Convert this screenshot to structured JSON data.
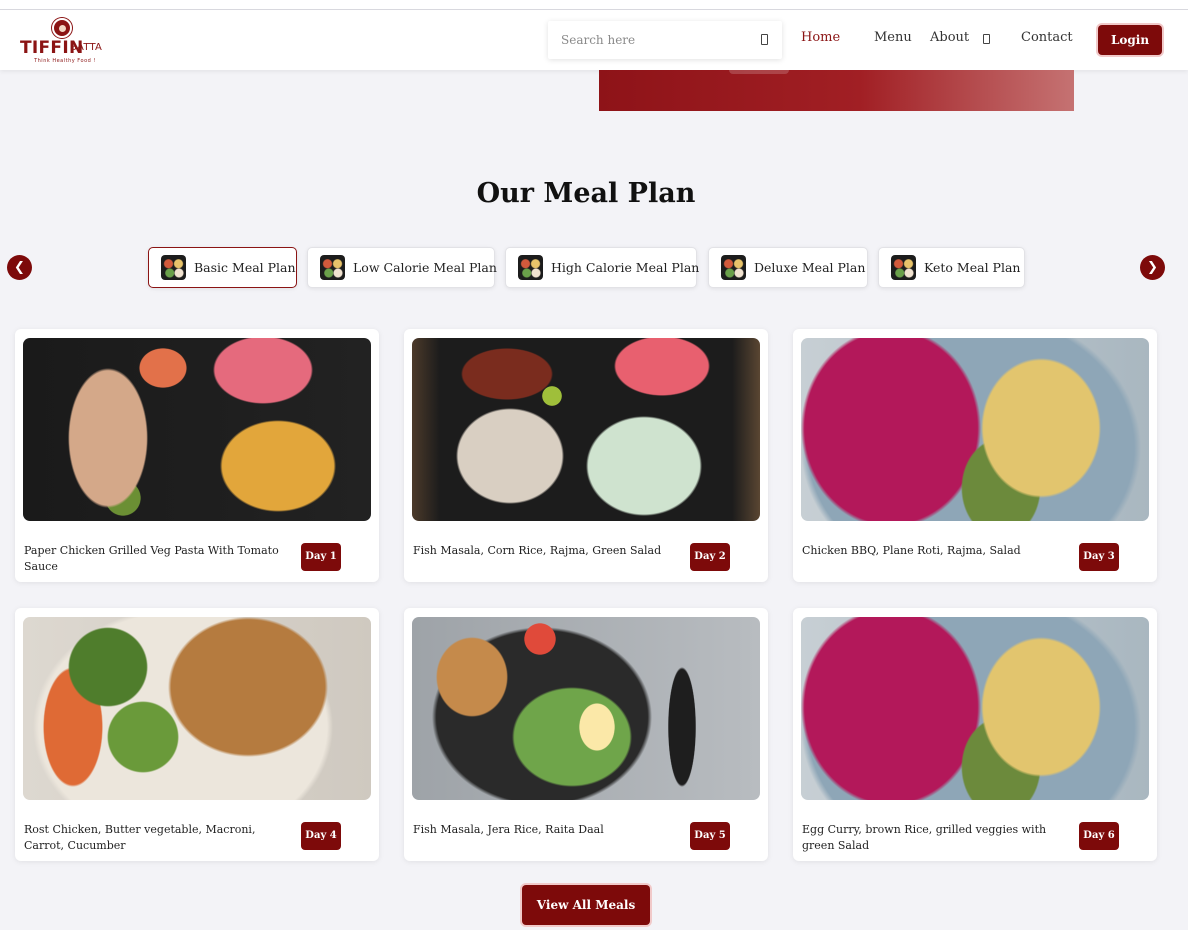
{
  "brand": {
    "name_main": "TIFFIN",
    "name_sub": "BATTA",
    "tagline": "Think Healthy Food !",
    "color": "#8b1414"
  },
  "header": {
    "search_placeholder": "Search here",
    "search_icon": "search-icon",
    "nav": [
      {
        "label": "Home",
        "active": true
      },
      {
        "label": "Menu",
        "active": false
      },
      {
        "label": "About",
        "active": false
      },
      {
        "label": "Contact",
        "active": false
      }
    ],
    "about_dropdown_icon": "chevron-down-icon",
    "login_label": "Login"
  },
  "section": {
    "title": "Our Meal Plan"
  },
  "carousel": {
    "prev_label": "❮",
    "next_label": "❯",
    "tabs": [
      {
        "label": "Basic Meal Plan",
        "active": true
      },
      {
        "label": "Low Calorie Meal Plan",
        "active": false
      },
      {
        "label": "High Calorie Meal Plan",
        "active": false
      },
      {
        "label": "Deluxe Meal Plan",
        "active": false
      },
      {
        "label": "Keto Meal Plan",
        "active": false
      }
    ]
  },
  "meals": [
    {
      "description": "Paper Chicken Grilled Veg Pasta With Tomato Sauce",
      "day": "Day 1",
      "image": "meal-tray-chicken-chickpeas"
    },
    {
      "description": "Fish Masala, Corn Rice, Rajma, Green Salad",
      "day": "Day 2",
      "image": "meal-tray-rice-salad"
    },
    {
      "description": "Chicken BBQ, Plane Roti, Rajma, Salad",
      "day": "Day 3",
      "image": "plate-cabbage-chicken"
    },
    {
      "description": "Rost Chicken, Butter vegetable, Macroni, Carrot, Cucumber",
      "day": "Day 4",
      "image": "plate-crusted-chicken-veg"
    },
    {
      "description": "Fish Masala, Jera Rice, Raita Daal",
      "day": "Day 5",
      "image": "lunchbox-salad-almonds"
    },
    {
      "description": "Egg Curry, brown Rice, grilled veggies with green Salad",
      "day": "Day 6",
      "image": "plate-cabbage-chicken"
    }
  ],
  "view_all_label": "View All Meals",
  "colors": {
    "accent": "#7d0a0a",
    "background": "#f3f3f7"
  }
}
